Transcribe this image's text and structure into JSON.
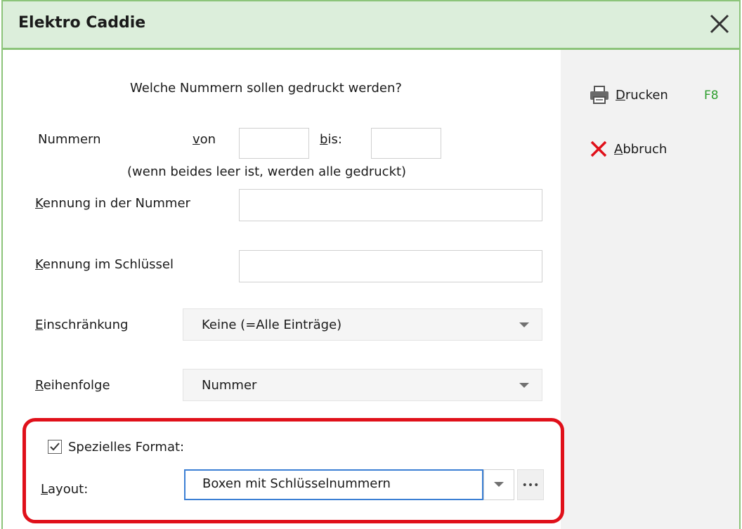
{
  "window": {
    "title": "Elektro Caddie"
  },
  "form": {
    "heading": "Welche Nummern sollen gedruckt werden?",
    "nummern_label": "Nummern",
    "von_label_ul": "v",
    "von_label_rest": "on",
    "von_value": "",
    "bis_label_ul": "b",
    "bis_label_rest": "is:",
    "bis_value": "",
    "hint": "(wenn beides leer ist, werden alle gedruckt)",
    "kennung_nummer_ul": "K",
    "kennung_nummer_rest": "ennung in der Nummer",
    "kennung_nummer_value": "",
    "kennung_schluessel_ul": "K",
    "kennung_schluessel_rest": "ennung im Schlüssel",
    "kennung_schluessel_value": "",
    "einschraenkung_ul": "E",
    "einschraenkung_rest": "inschränkung",
    "einschraenkung_value": "Keine (=Alle Einträge)",
    "reihenfolge_ul": "R",
    "reihenfolge_rest": "eihenfolge",
    "reihenfolge_value": "Nummer",
    "spezielles_format_label": "Spezielles Format:",
    "spezielles_format_checked": true,
    "layout_ul": "L",
    "layout_rest": "ayout:",
    "layout_value": "Boxen  mit Schlüsselnummern",
    "more_button": "•••"
  },
  "sidebar": {
    "drucken_ul": "D",
    "drucken_rest": "rucken",
    "drucken_shortcut": "F8",
    "abbruch_ul": "A",
    "abbruch_rest": "bbruch"
  },
  "colors": {
    "title_bg": "#dceedb",
    "accent_border": "#8cc47a",
    "highlight": "#e0101a",
    "shortcut": "#2e9e2e",
    "abbruch_icon": "#e0101a"
  },
  "icons": [
    "close-icon",
    "printer-icon",
    "cancel-x-icon",
    "checkmark-icon",
    "chevron-down-icon"
  ]
}
